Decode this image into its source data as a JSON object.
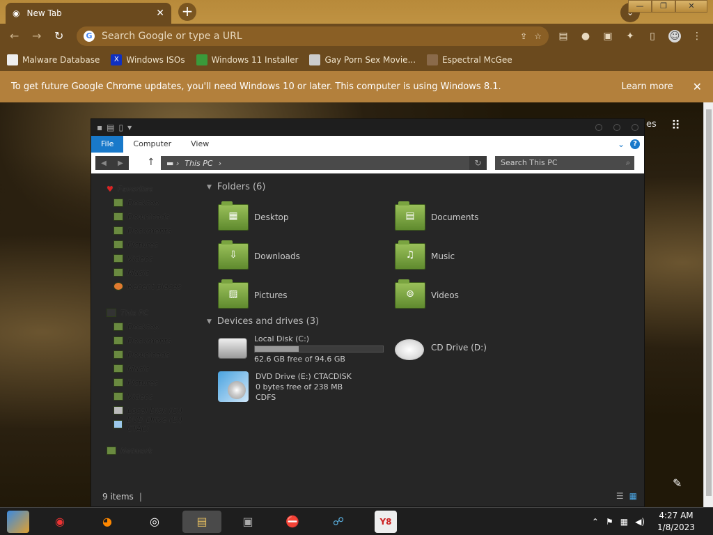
{
  "browser": {
    "tab_title": "New Tab",
    "omnibox_placeholder": "Search Google or type a URL",
    "bookmarks": [
      "Malware Database",
      "Windows ISOs",
      "Windows 11 Installer",
      "Gay Porn Sex Movie...",
      "Espectral McGee"
    ],
    "infobar": {
      "message": "To get future Google Chrome updates, you'll need Windows 10 or later. This computer is using Windows 8.1.",
      "learn_more": "Learn more"
    },
    "page_partial_text": "es"
  },
  "explorer": {
    "ribbon_tabs": [
      "File",
      "Computer",
      "View"
    ],
    "address_path": "This PC",
    "search_placeholder": "Search This PC",
    "nav": {
      "favorites": "Favorites",
      "fav_items": [
        "Desktop",
        "Downloads",
        "Documents",
        "Pictures",
        "Videos",
        "Music",
        "Recent places"
      ],
      "this_pc": "This PC",
      "pc_items": [
        "Desktop",
        "Documents",
        "Downloads",
        "Music",
        "Pictures",
        "Videos",
        "Local Disk (C:)",
        "DVD Drive (E:) CTACI"
      ],
      "network": "Network"
    },
    "folders_header": "Folders (6)",
    "folders": [
      "Desktop",
      "Documents",
      "Downloads",
      "Music",
      "Pictures",
      "Videos"
    ],
    "devices_header": "Devices and drives (3)",
    "drives": [
      {
        "name": "Local Disk (C:)",
        "free": "62.6 GB free of 94.6 GB",
        "used_fraction": 0.34
      },
      {
        "name": "CD Drive (D:)"
      },
      {
        "name": "DVD Drive (E:) CTACDISK",
        "free": "0 bytes free of 238 MB",
        "fs": "CDFS"
      }
    ],
    "status": "9 items"
  },
  "taskbar": {
    "time": "4:27 AM",
    "date": "1/8/2023"
  }
}
